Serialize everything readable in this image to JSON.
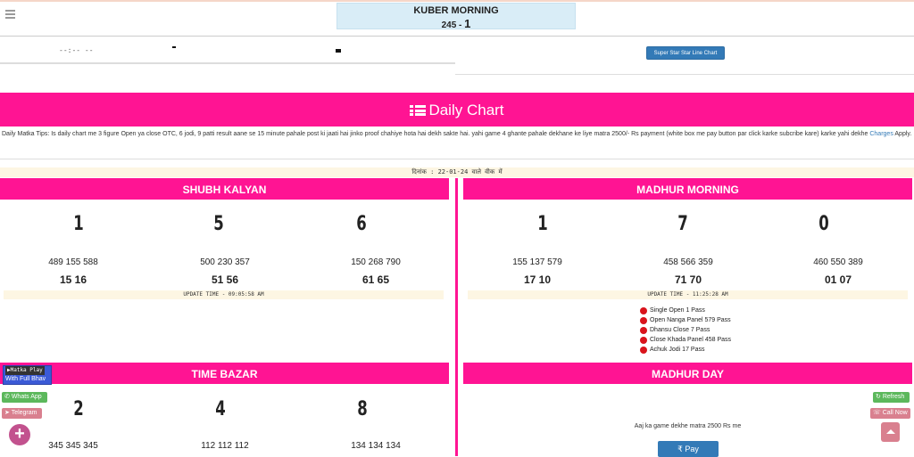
{
  "header": {
    "kuber_title": "KUBER MORNING",
    "kuber_result_prefix": "245 - ",
    "kuber_result_digit": "1",
    "time_text": "--:-- --",
    "dash_left": "-",
    "dash_right": "-",
    "line_chart_button": "Super Star Star Line Chart"
  },
  "daily_chart": {
    "title": "Daily Chart",
    "tips": "Daily Matka Tips: Is daily chart me 3 figure Open ya close OTC, 6 jodi, 9 patti result aane se 15 minute pahale post ki jaati hai jinko proof chahiye hota hai dekh sakte hai. yahi game 4 ghante pahale dekhane ke liye matra 2500/- Rs payment (white box me pay button par click karke subcribe kare) karke yahi dekhe ",
    "tips_link": "Charges",
    "tips_end": " Apply.",
    "date_line": "दिनांक : 22-01-24 वाले वीक में"
  },
  "cards": {
    "shubh_kalyan": {
      "title": "SHUBH KALYAN",
      "digits": [
        "1",
        "5",
        "6"
      ],
      "panels": [
        "489 155 588",
        "500 230 357",
        "150 268 790"
      ],
      "jodis": [
        "15 16",
        "51 56",
        "61 65"
      ],
      "update": "UPDATE TIME - 09:05:58 AM"
    },
    "madhur_morning": {
      "title": "MADHUR MORNING",
      "digits": [
        "1",
        "7",
        "0"
      ],
      "panels": [
        "155 137 579",
        "458 566 359",
        "460 550 389"
      ],
      "jodis": [
        "17 10",
        "71 70",
        "01 07"
      ],
      "update": "UPDATE TIME - 11:25:28 AM",
      "pass_list": [
        "Single Open 1 Pass",
        "Open Nanga Panel 579 Pass",
        "Dhansu Close 7 Pass",
        "Close Khada Panel 458 Pass",
        "Achuk Jodi 17 Pass"
      ]
    },
    "time_bazar": {
      "title": "TIME BAZAR",
      "digits": [
        "2",
        "4",
        "8"
      ],
      "panels": [
        "345 345 345",
        "112 112 112",
        "134 134 134"
      ]
    },
    "madhur_day": {
      "title": "MADHUR DAY",
      "message": "Aaj ka game dekhe matra 2500 Rs me",
      "pay_button": "₹ Pay"
    }
  },
  "floating": {
    "matka_play_line1": "▶Matka Play",
    "matka_play_line2": "With Full Bhav",
    "whatsapp": "Whats App",
    "telegram": "Telegram",
    "refresh": "Refresh",
    "call_now": "Call Now",
    "plus": "+"
  },
  "colors": {
    "pink": "#ff1493",
    "blue": "#337ab7",
    "green": "#5cb85c"
  }
}
